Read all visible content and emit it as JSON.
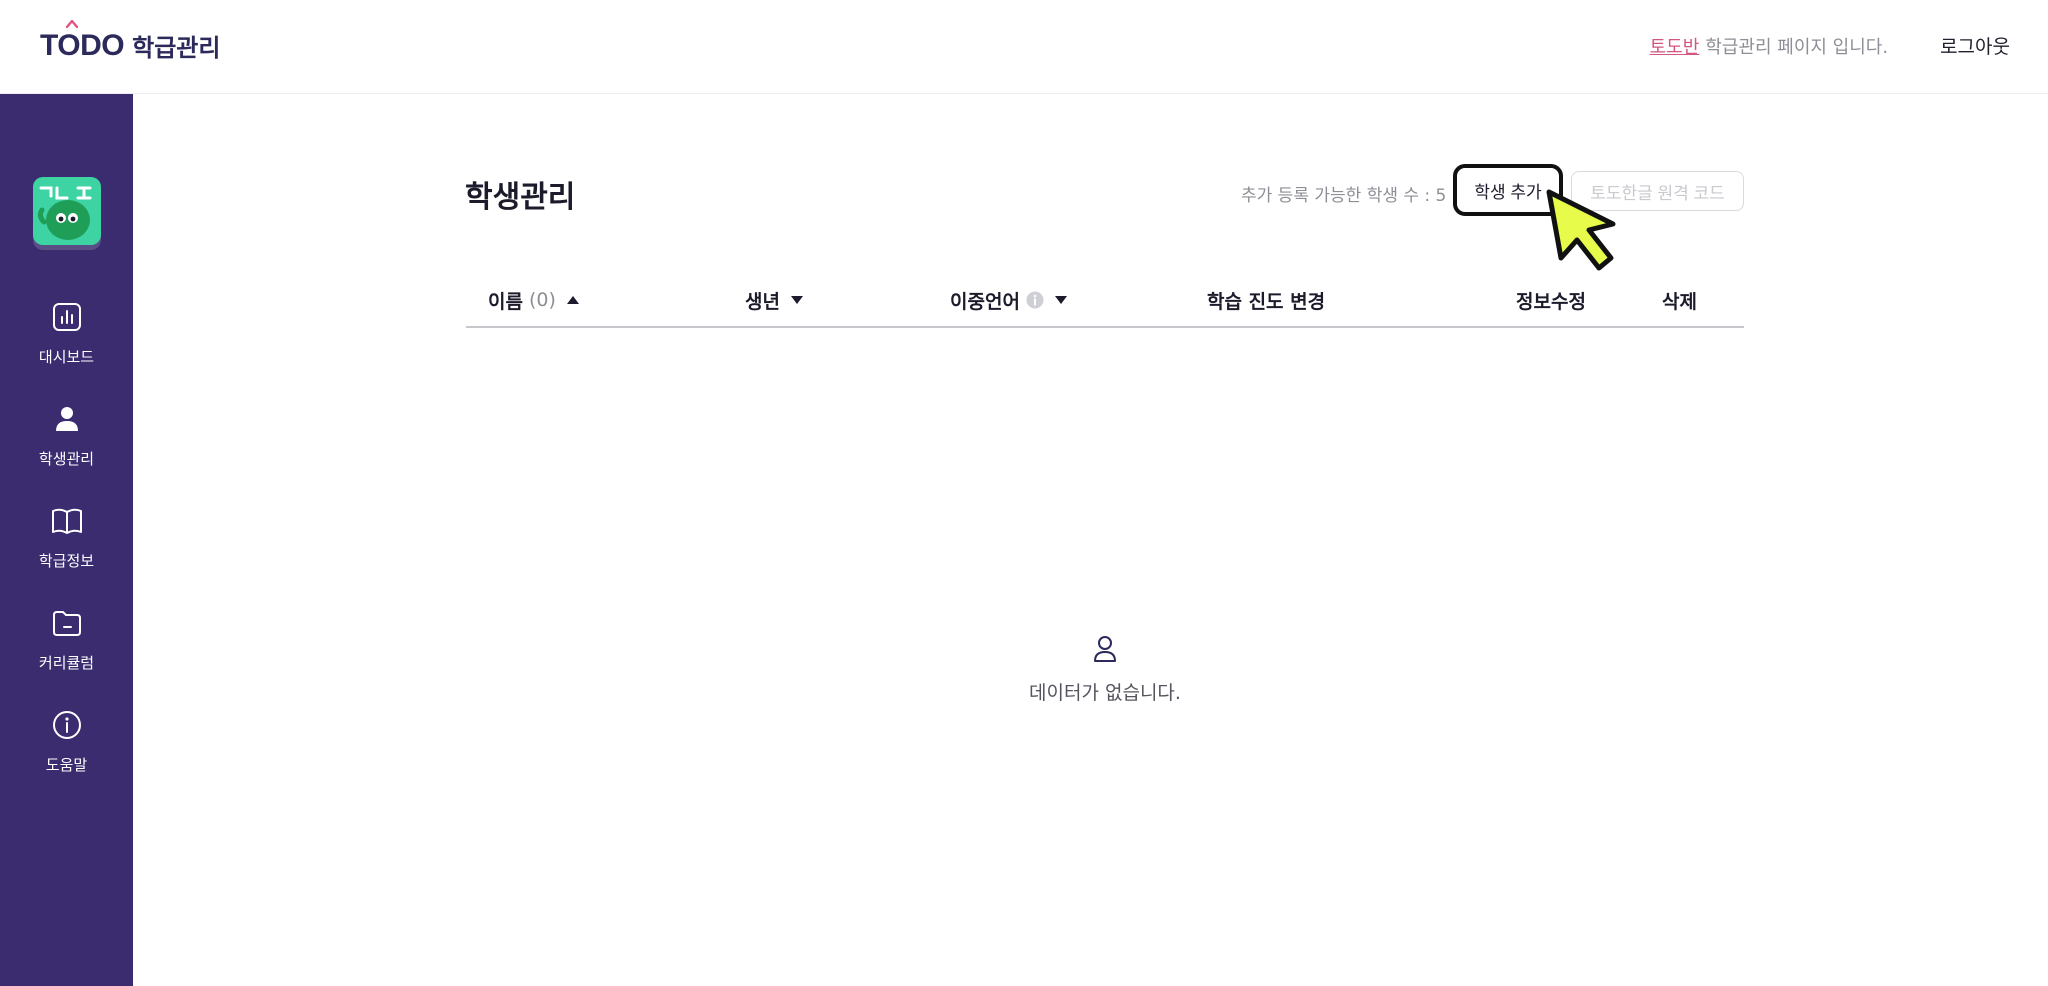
{
  "header": {
    "logo_text": "TODO",
    "logo_sub": "학급관리",
    "class_name": "토도반",
    "class_suffix": "학급관리 페이지 입니다.",
    "logout_label": "로그아웃"
  },
  "sidebar": {
    "avatar_text": "가나다",
    "items": [
      {
        "label": "대시보드",
        "icon": "chart-icon"
      },
      {
        "label": "학생관리",
        "icon": "user-icon"
      },
      {
        "label": "학급정보",
        "icon": "book-icon"
      },
      {
        "label": "커리큘럼",
        "icon": "folder-icon"
      },
      {
        "label": "도움말",
        "icon": "info-icon"
      }
    ]
  },
  "main": {
    "title": "학생관리",
    "quota_text": "추가 등록 가능한 학생 수 : 5",
    "add_button": "학생 추가",
    "code_button": "토도한글 원격 코드",
    "columns": {
      "name": "이름",
      "name_count": "(0)",
      "birth": "생년",
      "bilingual": "이중언어",
      "progress": "학습 진도 변경",
      "edit": "정보수정",
      "delete": "삭제"
    },
    "empty_text": "데이터가 없습니다."
  },
  "colors": {
    "sidebar_bg": "#3a2c6f",
    "accent_pink": "#d2567f",
    "cursor_yellow": "#e6fb4a"
  }
}
